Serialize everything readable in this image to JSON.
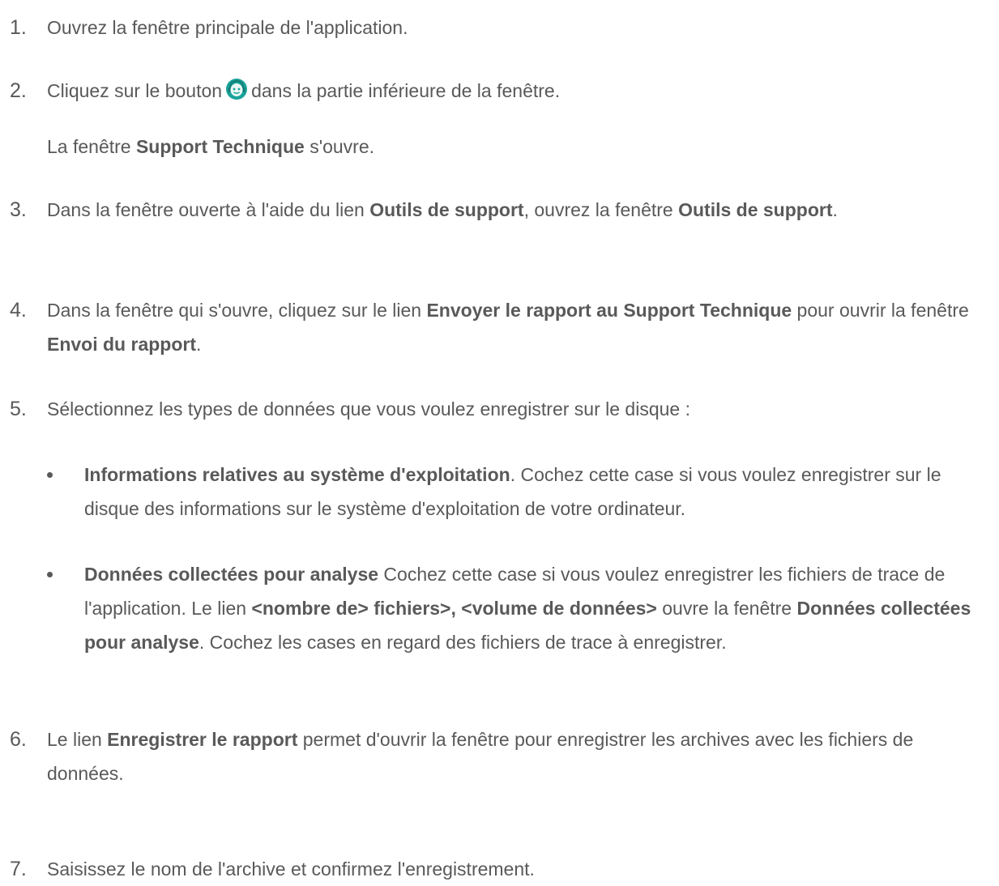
{
  "steps": [
    {
      "number": "1.",
      "parts": [
        "Ouvrez la fenêtre principale de l'application."
      ]
    },
    {
      "number": "2.",
      "before_icon": "Cliquez sur le bouton",
      "icon": "support-agent-icon",
      "after_icon": "dans la partie inférieure de la fenêtre.",
      "note": {
        "pre": "La fenêtre ",
        "bold": "Support Technique",
        "post": " s'ouvre."
      }
    },
    {
      "number": "3.",
      "pre": "Dans la fenêtre ouverte à l'aide du lien ",
      "bold1": "Outils de support",
      "mid": ", ouvrez la fenêtre ",
      "bold2": "Outils de support",
      "post": "."
    },
    {
      "number": "4.",
      "pre": "Dans la fenêtre qui s'ouvre, cliquez sur le lien ",
      "bold1": "Envoyer le rapport au Support Technique",
      "mid": " pour ouvrir la fenêtre ",
      "bold2": "Envoi du rapport",
      "post": "."
    },
    {
      "number": "5.",
      "text": "Sélectionnez les types de données que vous voulez enregistrer sur le disque :",
      "bullets": [
        {
          "bold": "Informations relatives au système d'exploitation",
          "text": ". Cochez cette case si vous voulez enregistrer sur le disque des informations sur le système d'exploitation de votre ordinateur."
        },
        {
          "bold": "Données collectées pour analyse",
          "text1": " Cochez cette case si vous voulez enregistrer les fichiers de trace de l'application. Le lien ",
          "bold2": "<nombre de> fichiers>, <volume de données>",
          "text2": " ouvre la fenêtre ",
          "bold3": "Données collectées pour analyse",
          "text3": ". Cochez les cases en regard des fichiers de trace à enregistrer."
        }
      ]
    },
    {
      "number": "6.",
      "pre": "Le lien ",
      "bold": "Enregistrer le rapport",
      "post": " permet d'ouvrir la fenêtre pour enregistrer les archives avec les fichiers de données."
    },
    {
      "number": "7.",
      "text": "Saisissez le nom de l'archive et confirmez l'enregistrement."
    }
  ],
  "colors": {
    "text": "#595959",
    "icon_teal": "#1aa39a",
    "icon_face": "#e9f7f5"
  }
}
